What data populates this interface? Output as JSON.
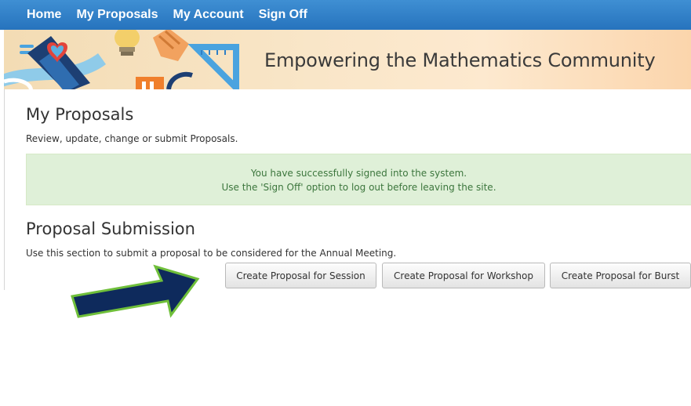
{
  "nav": {
    "home": "Home",
    "my_proposals": "My Proposals",
    "my_account": "My Account",
    "sign_off": "Sign Off"
  },
  "banner": {
    "title": "Empowering the Mathematics Community"
  },
  "page": {
    "title": "My Proposals",
    "subtitle": "Review, update, change or submit Proposals."
  },
  "alert": {
    "line1": "You have successfully signed into the system.",
    "line2": "Use the 'Sign Off' option to log out before leaving the site."
  },
  "submission": {
    "title": "Proposal Submission",
    "description": "Use this section to submit a proposal to be considered for the Annual Meeting.",
    "buttons": {
      "session": "Create Proposal for Session",
      "workshop": "Create Proposal for Workshop",
      "burst": "Create Proposal for Burst"
    }
  },
  "colors": {
    "nav_bar": "#2f7fc6",
    "alert_bg": "#dff0d8",
    "alert_text": "#3c763d",
    "arrow_fill": "#0e2a5c",
    "arrow_outline": "#6fbf3a"
  },
  "icons": {
    "banner_art": "math-tools-illustration",
    "annotation": "arrow-pointing-right-icon"
  }
}
